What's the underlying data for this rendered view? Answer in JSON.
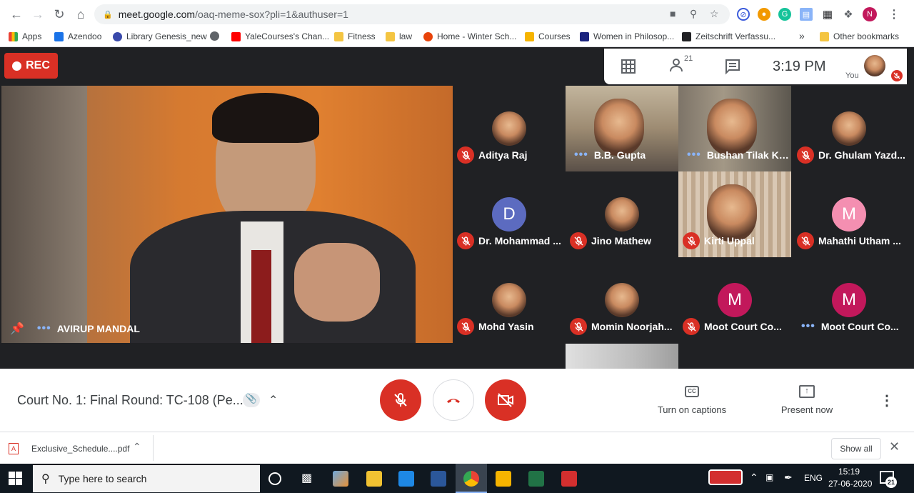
{
  "browser": {
    "url_host": "meet.google.com",
    "url_path": "/oaq-meme-sox?pli=1&authuser=1",
    "profile_initial": "N",
    "bookmarks": [
      "Apps",
      "Azendoo",
      "Library Genesis_new",
      "",
      "YaleCourses's Chan...",
      "Fitness",
      "law",
      "Home - Winter Sch...",
      "Courses",
      "Women in Philosop...",
      "Zeitschrift Verfassu..."
    ],
    "overflow": "»",
    "other_bookmarks": "Other bookmarks"
  },
  "meet": {
    "rec_label": "REC",
    "people_count": "21",
    "time": "3:19 PM",
    "you_label": "You",
    "main_speaker": "AVIRUP MANDAL",
    "participants": [
      {
        "name": "Aditya Raj",
        "muted": true,
        "type": "avatar"
      },
      {
        "name": "B.B. Gupta",
        "muted": false,
        "type": "video"
      },
      {
        "name": "Bushan Tilak Kaul",
        "muted": false,
        "type": "video"
      },
      {
        "name": "Dr. Ghulam Yazd...",
        "muted": true,
        "type": "avatar"
      },
      {
        "name": "Dr. Mohammad ...",
        "muted": true,
        "type": "letter",
        "letter": "D",
        "color": "#5c6bc0"
      },
      {
        "name": "Jino Mathew",
        "muted": true,
        "type": "avatar"
      },
      {
        "name": "Kirti Uppal",
        "muted": true,
        "type": "video"
      },
      {
        "name": "Mahathi Utham ...",
        "muted": true,
        "type": "letter",
        "letter": "M",
        "color": "#f48fb1"
      },
      {
        "name": "Mohd Yasin",
        "muted": true,
        "type": "avatar"
      },
      {
        "name": "Momin Noorjah...",
        "muted": true,
        "type": "avatar"
      },
      {
        "name": "Moot Court Co...",
        "muted": true,
        "type": "letter",
        "letter": "M",
        "color": "#c2185b"
      },
      {
        "name": "Moot Court Co...",
        "muted": false,
        "type": "letter",
        "letter": "M",
        "color": "#c2185b"
      }
    ],
    "meeting_title": "Court No. 1: Final Round: TC-108 (Pe...",
    "captions_label": "Turn on captions",
    "present_label": "Present now"
  },
  "downloads": {
    "file": "Exclusive_Schedule....pdf",
    "show_all": "Show all"
  },
  "taskbar": {
    "search_placeholder": "Type here to search",
    "lang": "ENG",
    "time": "15:19",
    "date": "27-06-2020",
    "notif_count": "21"
  },
  "colors": {
    "accent_red": "#d93025",
    "meet_bg": "#202124",
    "dots": "#8ab4f8"
  }
}
